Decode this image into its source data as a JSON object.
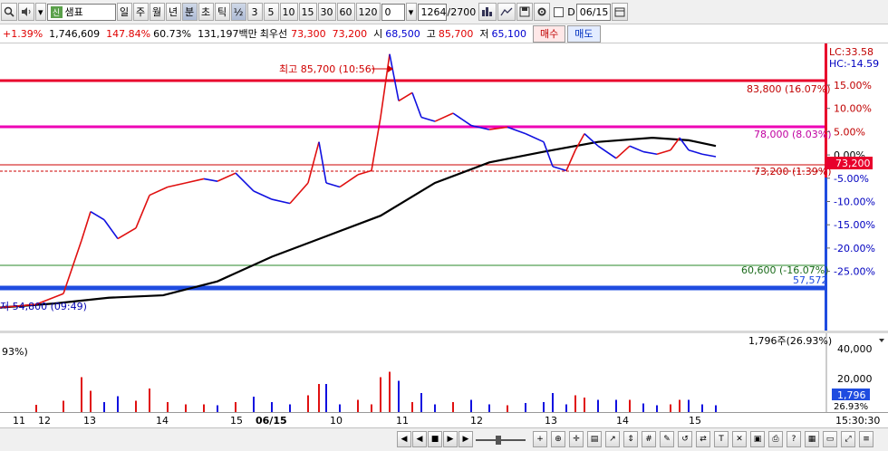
{
  "toolbar": {
    "search_icon": "magnifier-icon",
    "sound_icon": "speaker-icon",
    "stock_name": "샘표",
    "market_tag": "신",
    "periods": [
      "일",
      "주",
      "월",
      "년",
      "분",
      "초",
      "틱"
    ],
    "active_period": "분",
    "fraction": "½",
    "intervals": [
      "3",
      "5",
      "10",
      "15",
      "30",
      "60",
      "120"
    ],
    "offset": "0",
    "count": "1264",
    "total": "/2700",
    "date": "06/15",
    "date_prefix": "D"
  },
  "quote": {
    "change_pct": "+1.39%",
    "volume": "1,746,609",
    "vol_ratio": "147.84%",
    "turnover": "60.73%",
    "amount": "131,197백만",
    "priority_label": "최우선",
    "priority_ask": "73,300",
    "priority_bid": "73,200",
    "open_label": "시",
    "open": "68,500",
    "high_label": "고",
    "high": "85,700",
    "low_label": "저",
    "low": "65,100",
    "buy_label": "매수",
    "sell_label": "매도"
  },
  "chart_labels": {
    "high_annotation": "최고 85,700 (10:56)",
    "low_annotation": "저 54,800 (09:49)",
    "lc": "LC:33.58",
    "hc": "HC:-14.59",
    "line_83800": "83,800 (16.07%)",
    "line_78000": "78,000 (8.03%)",
    "line_73200": "73,200 (1.39%)",
    "line_60600": "60,600 (-16.07%)",
    "line_57572": "57,572",
    "current_price": "73,200",
    "volume_label": "1,796주(26.93%)",
    "volume_left": "93%)",
    "volume_current": "1,796",
    "volume_pct": "26.93%"
  },
  "colors": {
    "resistance": "#e8002c",
    "magenta": "#ee00b4",
    "support_blue": "#1f4ce0",
    "green_line": "#2a8a2a",
    "ma_line": "#000000",
    "up_candle": "#e01010",
    "down_candle": "#1010e0"
  },
  "chart_data": {
    "type": "line",
    "pct_ticks": [
      "15.00%",
      "10.00%",
      "5.00%",
      "0.00%",
      "-5.00%",
      "-10.00%",
      "-15.00%",
      "-20.00%",
      "-25.00%"
    ],
    "volume_ticks": [
      "40,000",
      "20,000"
    ],
    "x_ticks": [
      "11",
      "12",
      "13",
      "14",
      "15",
      "06/15",
      "10",
      "11",
      "12",
      "13",
      "14",
      "15",
      "15:30:30"
    ],
    "price_series": [
      [
        0,
        54800
      ],
      [
        40,
        55200
      ],
      [
        70,
        56500
      ],
      [
        90,
        63000
      ],
      [
        100,
        66500
      ],
      [
        115,
        65500
      ],
      [
        130,
        63200
      ],
      [
        150,
        64500
      ],
      [
        165,
        68500
      ],
      [
        185,
        69500
      ],
      [
        205,
        70000
      ],
      [
        225,
        70500
      ],
      [
        240,
        70200
      ],
      [
        260,
        71200
      ],
      [
        280,
        69000
      ],
      [
        300,
        68000
      ],
      [
        320,
        67500
      ],
      [
        340,
        70000
      ],
      [
        352,
        75000
      ],
      [
        360,
        70000
      ],
      [
        375,
        69500
      ],
      [
        395,
        71000
      ],
      [
        410,
        71500
      ],
      [
        420,
        78000
      ],
      [
        430,
        85700
      ],
      [
        440,
        80000
      ],
      [
        455,
        81000
      ],
      [
        465,
        78000
      ],
      [
        480,
        77500
      ],
      [
        500,
        78500
      ],
      [
        520,
        77000
      ],
      [
        540,
        76500
      ],
      [
        560,
        76800
      ],
      [
        580,
        76000
      ],
      [
        600,
        75000
      ],
      [
        610,
        72000
      ],
      [
        625,
        71500
      ],
      [
        635,
        74000
      ],
      [
        645,
        76000
      ],
      [
        660,
        74500
      ],
      [
        680,
        73000
      ],
      [
        695,
        74500
      ],
      [
        710,
        73800
      ],
      [
        725,
        73500
      ],
      [
        740,
        74000
      ],
      [
        750,
        75500
      ],
      [
        760,
        74000
      ],
      [
        775,
        73500
      ],
      [
        790,
        73200
      ]
    ],
    "moving_average": [
      [
        0,
        54800
      ],
      [
        60,
        55300
      ],
      [
        120,
        56000
      ],
      [
        180,
        56300
      ],
      [
        240,
        58000
      ],
      [
        300,
        61000
      ],
      [
        360,
        63500
      ],
      [
        420,
        66000
      ],
      [
        480,
        70000
      ],
      [
        540,
        72500
      ],
      [
        600,
        73800
      ],
      [
        660,
        75000
      ],
      [
        720,
        75500
      ],
      [
        760,
        75200
      ],
      [
        790,
        74500
      ]
    ],
    "ylim": [
      52000,
      87000
    ]
  }
}
